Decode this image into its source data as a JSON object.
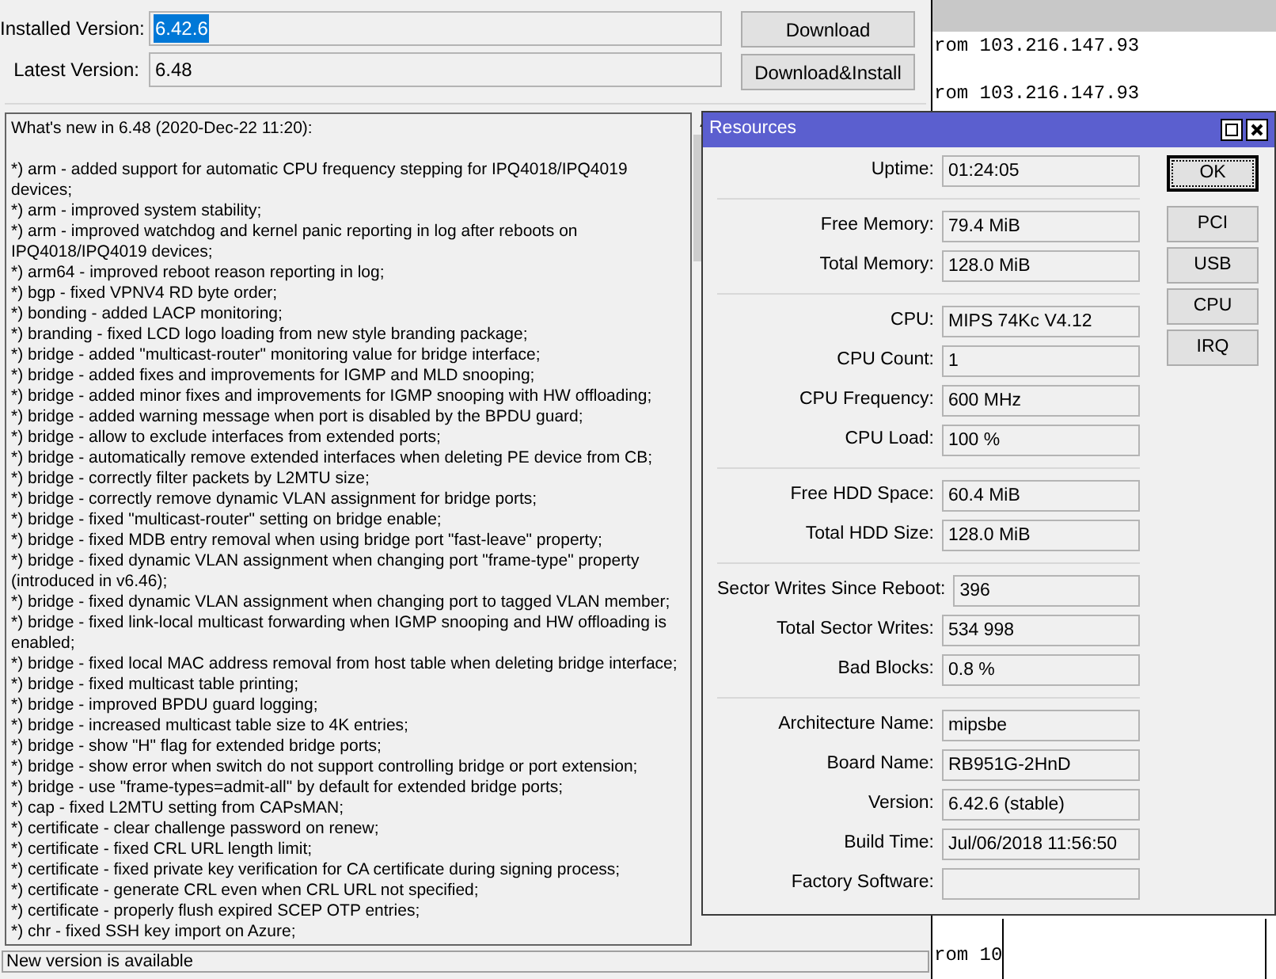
{
  "upgrade_panel": {
    "fields": [
      {
        "label": "Installed Version:",
        "value": "6.42.6",
        "highlighted": true
      },
      {
        "label": "Latest Version:",
        "value": "6.48",
        "highlighted": false
      }
    ],
    "buttons": [
      "Download",
      "Download&Install"
    ],
    "changelog_header": "What's new in 6.48 (2020-Dec-22 11:20):",
    "changelog_lines": [
      "*) arm - added support for automatic CPU frequency stepping for IPQ4018/IPQ4019",
      "devices;",
      "*) arm - improved system stability;",
      "*) arm - improved watchdog and kernel panic reporting in log after reboots on",
      "IPQ4018/IPQ4019 devices;",
      "*) arm64 - improved reboot reason reporting in log;",
      "*) bgp - fixed VPNV4 RD byte order;",
      "*) bonding - added LACP monitoring;",
      "*) branding - fixed LCD logo loading from new style branding package;",
      "*) bridge - added \"multicast-router\" monitoring value for bridge interface;",
      "*) bridge - added fixes and improvements for IGMP and MLD snooping;",
      "*) bridge - added minor fixes and improvements for IGMP snooping with HW offloading;",
      "*) bridge - added warning message when port is disabled by the BPDU guard;",
      "*) bridge - allow to exclude interfaces from extended ports;",
      "*) bridge - automatically remove extended interfaces when deleting PE device from CB;",
      "*) bridge - correctly filter packets by L2MTU size;",
      "*) bridge - correctly remove dynamic VLAN assignment for bridge ports;",
      "*) bridge - fixed \"multicast-router\" setting on bridge enable;",
      "*) bridge - fixed MDB entry removal when using bridge port \"fast-leave\" property;",
      "*) bridge - fixed dynamic VLAN assignment when changing port \"frame-type\" property",
      "(introduced in v6.46);",
      "*) bridge - fixed dynamic VLAN assignment when changing port to tagged VLAN member;",
      "*) bridge - fixed link-local multicast forwarding when IGMP snooping and HW offloading is",
      "enabled;",
      "*) bridge - fixed local MAC address removal from host table when deleting bridge interface;",
      "*) bridge - fixed multicast table printing;",
      "*) bridge - improved BPDU guard logging;",
      "*) bridge - increased multicast table size to 4K entries;",
      "*) bridge - show \"H\" flag for extended bridge ports;",
      "*) bridge - show error when switch do not support controlling bridge or port extension;",
      "*) bridge - use \"frame-types=admit-all\" by default for extended bridge ports;",
      "*) cap - fixed L2MTU setting from CAPsMAN;",
      "*) certificate - clear challenge password on renew;",
      "*) certificate - fixed CRL URL length limit;",
      "*) certificate - fixed private key verification for CA certificate during signing process;",
      "*) certificate - generate CRL even when CRL URL not specified;",
      "*) certificate - properly flush expired SCEP OTP entries;",
      "*) chr - fixed SSH key import on Azure;"
    ],
    "status_bar": "New version is available"
  },
  "terminal": {
    "lines": [
      "rom 103.216.147.93",
      "rom 103.216.147.93"
    ],
    "bottom_line": "rom 10"
  },
  "resources_window": {
    "title": "Resources",
    "groups": [
      [
        {
          "label": "Uptime:",
          "value": "01:24:05"
        }
      ],
      [
        {
          "label": "Free Memory:",
          "value": "79.4 MiB"
        },
        {
          "label": "Total Memory:",
          "value": "128.0 MiB"
        }
      ],
      [
        {
          "label": "CPU:",
          "value": "MIPS 74Kc V4.12"
        },
        {
          "label": "CPU Count:",
          "value": "1"
        },
        {
          "label": "CPU Frequency:",
          "value": "600 MHz"
        },
        {
          "label": "CPU Load:",
          "value": "100 %"
        }
      ],
      [
        {
          "label": "Free HDD Space:",
          "value": "60.4 MiB"
        },
        {
          "label": "Total HDD Size:",
          "value": "128.0 MiB"
        }
      ],
      [
        {
          "label": "Sector Writes Since Reboot:",
          "value": "396"
        },
        {
          "label": "Total Sector Writes:",
          "value": "534 998"
        },
        {
          "label": "Bad Blocks:",
          "value": "0.8 %"
        }
      ],
      [
        {
          "label": "Architecture Name:",
          "value": "mipsbe"
        },
        {
          "label": "Board Name:",
          "value": "RB951G-2HnD"
        },
        {
          "label": "Version:",
          "value": "6.42.6 (stable)"
        },
        {
          "label": "Build Time:",
          "value": "Jul/06/2018 11:56:50"
        },
        {
          "label": "Factory Software:"
        }
      ]
    ],
    "buttons": [
      {
        "label": "OK",
        "focused": true
      },
      {
        "label": "PCI",
        "focused": false
      },
      {
        "label": "USB",
        "focused": false
      },
      {
        "label": "CPU",
        "focused": false
      },
      {
        "label": "IRQ",
        "focused": false
      }
    ]
  }
}
